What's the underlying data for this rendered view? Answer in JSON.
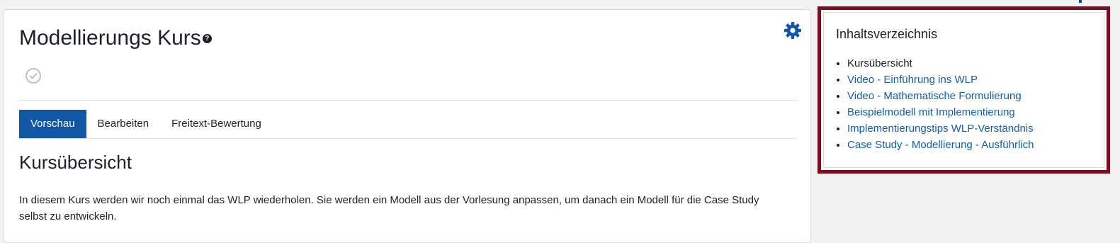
{
  "course": {
    "title": "Modellierungs Kurs",
    "help_symbol": "?"
  },
  "tabs": [
    {
      "label": "Vorschau",
      "active": true
    },
    {
      "label": "Bearbeiten",
      "active": false
    },
    {
      "label": "Freitext-Bewertung",
      "active": false
    }
  ],
  "content": {
    "section_title": "Kursübersicht",
    "intro": "In diesem Kurs werden wir noch einmal das WLP wiederholen. Sie werden ein Modell aus der Vorlesung anpassen, um danach ein Modell für die Case Study selbst zu entwickeln."
  },
  "toc": {
    "title": "Inhaltsverzeichnis",
    "items": [
      {
        "label": "Kursübersicht",
        "is_link": false
      },
      {
        "label": "Video - Einführung ins WLP",
        "is_link": true
      },
      {
        "label": "Video - Mathematische Formulierung",
        "is_link": true
      },
      {
        "label": "Beispielmodell mit Implementierung",
        "is_link": true
      },
      {
        "label": "Implementierungstips WLP-Verständnis",
        "is_link": true
      },
      {
        "label": "Case Study - Modellierung - Ausführlich",
        "is_link": true
      }
    ]
  },
  "icons": {
    "settings": "gear-icon",
    "completion": "check-circle-icon",
    "help": "question-circle-icon"
  },
  "colors": {
    "accent": "#1157a6",
    "link": "#0f5fae",
    "highlight_border": "#7a0d1f",
    "text": "#1d2125"
  }
}
